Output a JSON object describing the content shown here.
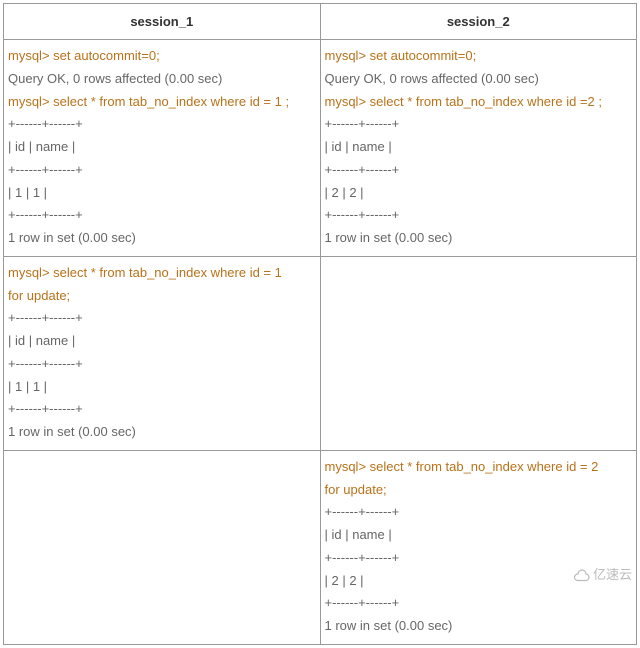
{
  "headers": {
    "col1": "session_1",
    "col2": "session_2"
  },
  "row1": {
    "s1_cmd1": "mysql> set autocommit=0;",
    "s1_out1": "Query OK, 0 rows affected (0.00 sec)",
    "s1_cmd2": "mysql> select * from tab_no_index where id = 1 ;",
    "s1_l1": "+------+------+",
    "s1_l2": "| id      | name |",
    "s1_l3": "+------+------+",
    "s1_l4": "| 1       | 1        |",
    "s1_l5": "+------+------+",
    "s1_l6": "1 row in set (0.00 sec)",
    "s2_cmd1": "mysql> set autocommit=0;",
    "s2_out1": "Query OK, 0 rows affected (0.00 sec)",
    "s2_cmd2": "mysql> select * from tab_no_index where id =2 ;",
    "s2_l1": "+------+------+",
    "s2_l2": "| id      | name |",
    "s2_l3": "+------+------+",
    "s2_l4": "| 2       | 2        |",
    "s2_l5": "+------+------+",
    "s2_l6": "1 row in set (0.00 sec)"
  },
  "row2": {
    "s1_cmd1a": "mysql> select * from tab_no_index where id = 1",
    "s1_cmd1b": "for update;",
    "s1_l1": "+------+------+",
    "s1_l2": "| id      | name |",
    "s1_l3": "+------+------+",
    "s1_l4": "| 1       | 1        |",
    "s1_l5": "+------+------+",
    "s1_l6": "1 row in set (0.00 sec)"
  },
  "row3": {
    "s2_cmd1a": "mysql> select * from tab_no_index where id = 2",
    "s2_cmd1b": "for update;",
    "s2_l1": "+------+------+",
    "s2_l2": "| id      | name |",
    "s2_l3": "+------+------+",
    "s2_l4": "| 2       | 2        |",
    "s2_l5": "+------+------+",
    "s2_l6": "1 row in set (0.00 sec)"
  },
  "watermark": "亿速云"
}
